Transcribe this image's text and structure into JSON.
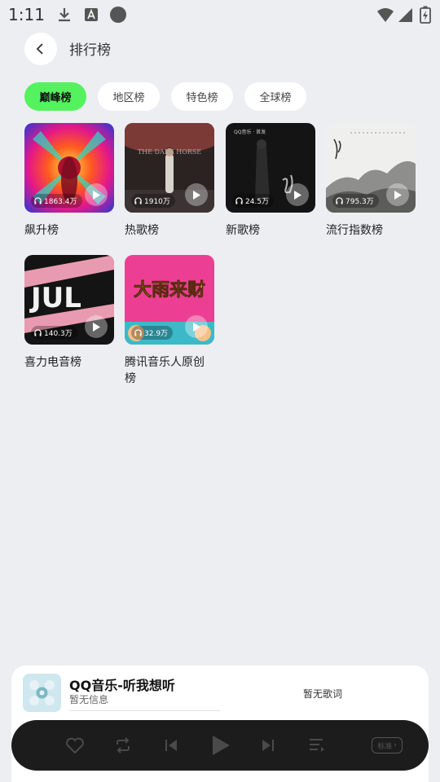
{
  "status_bar": {
    "time": "1:11"
  },
  "header": {
    "title": "排行榜"
  },
  "tabs": [
    {
      "label": "巅峰榜",
      "active": true
    },
    {
      "label": "地区榜",
      "active": false
    },
    {
      "label": "特色榜",
      "active": false
    },
    {
      "label": "全球榜",
      "active": false
    }
  ],
  "charts": [
    {
      "name": "飙升榜",
      "play_count": "1863.4万"
    },
    {
      "name": "热歌榜",
      "play_count": "1910万",
      "cover_text": "THE DARK HORSE"
    },
    {
      "name": "新歌榜",
      "play_count": "24.5万",
      "cover_text": "QQ音乐 · 首发"
    },
    {
      "name": "流行指数榜",
      "play_count": "795.3万"
    },
    {
      "name": "喜力电音榜",
      "play_count": "140.3万",
      "cover_text": "JUL"
    },
    {
      "name": "腾讯音乐人原创榜",
      "play_count": "32.9万",
      "cover_text": "大雨来财"
    }
  ],
  "player": {
    "title": "QQ音乐-听我想听",
    "subtitle": "暂无信息",
    "lyrics": "暂无歌词",
    "quality": "标准"
  },
  "colors": {
    "accent": "#55f25f",
    "background": "#eceef2",
    "player_bar": "#1c1c1c"
  }
}
